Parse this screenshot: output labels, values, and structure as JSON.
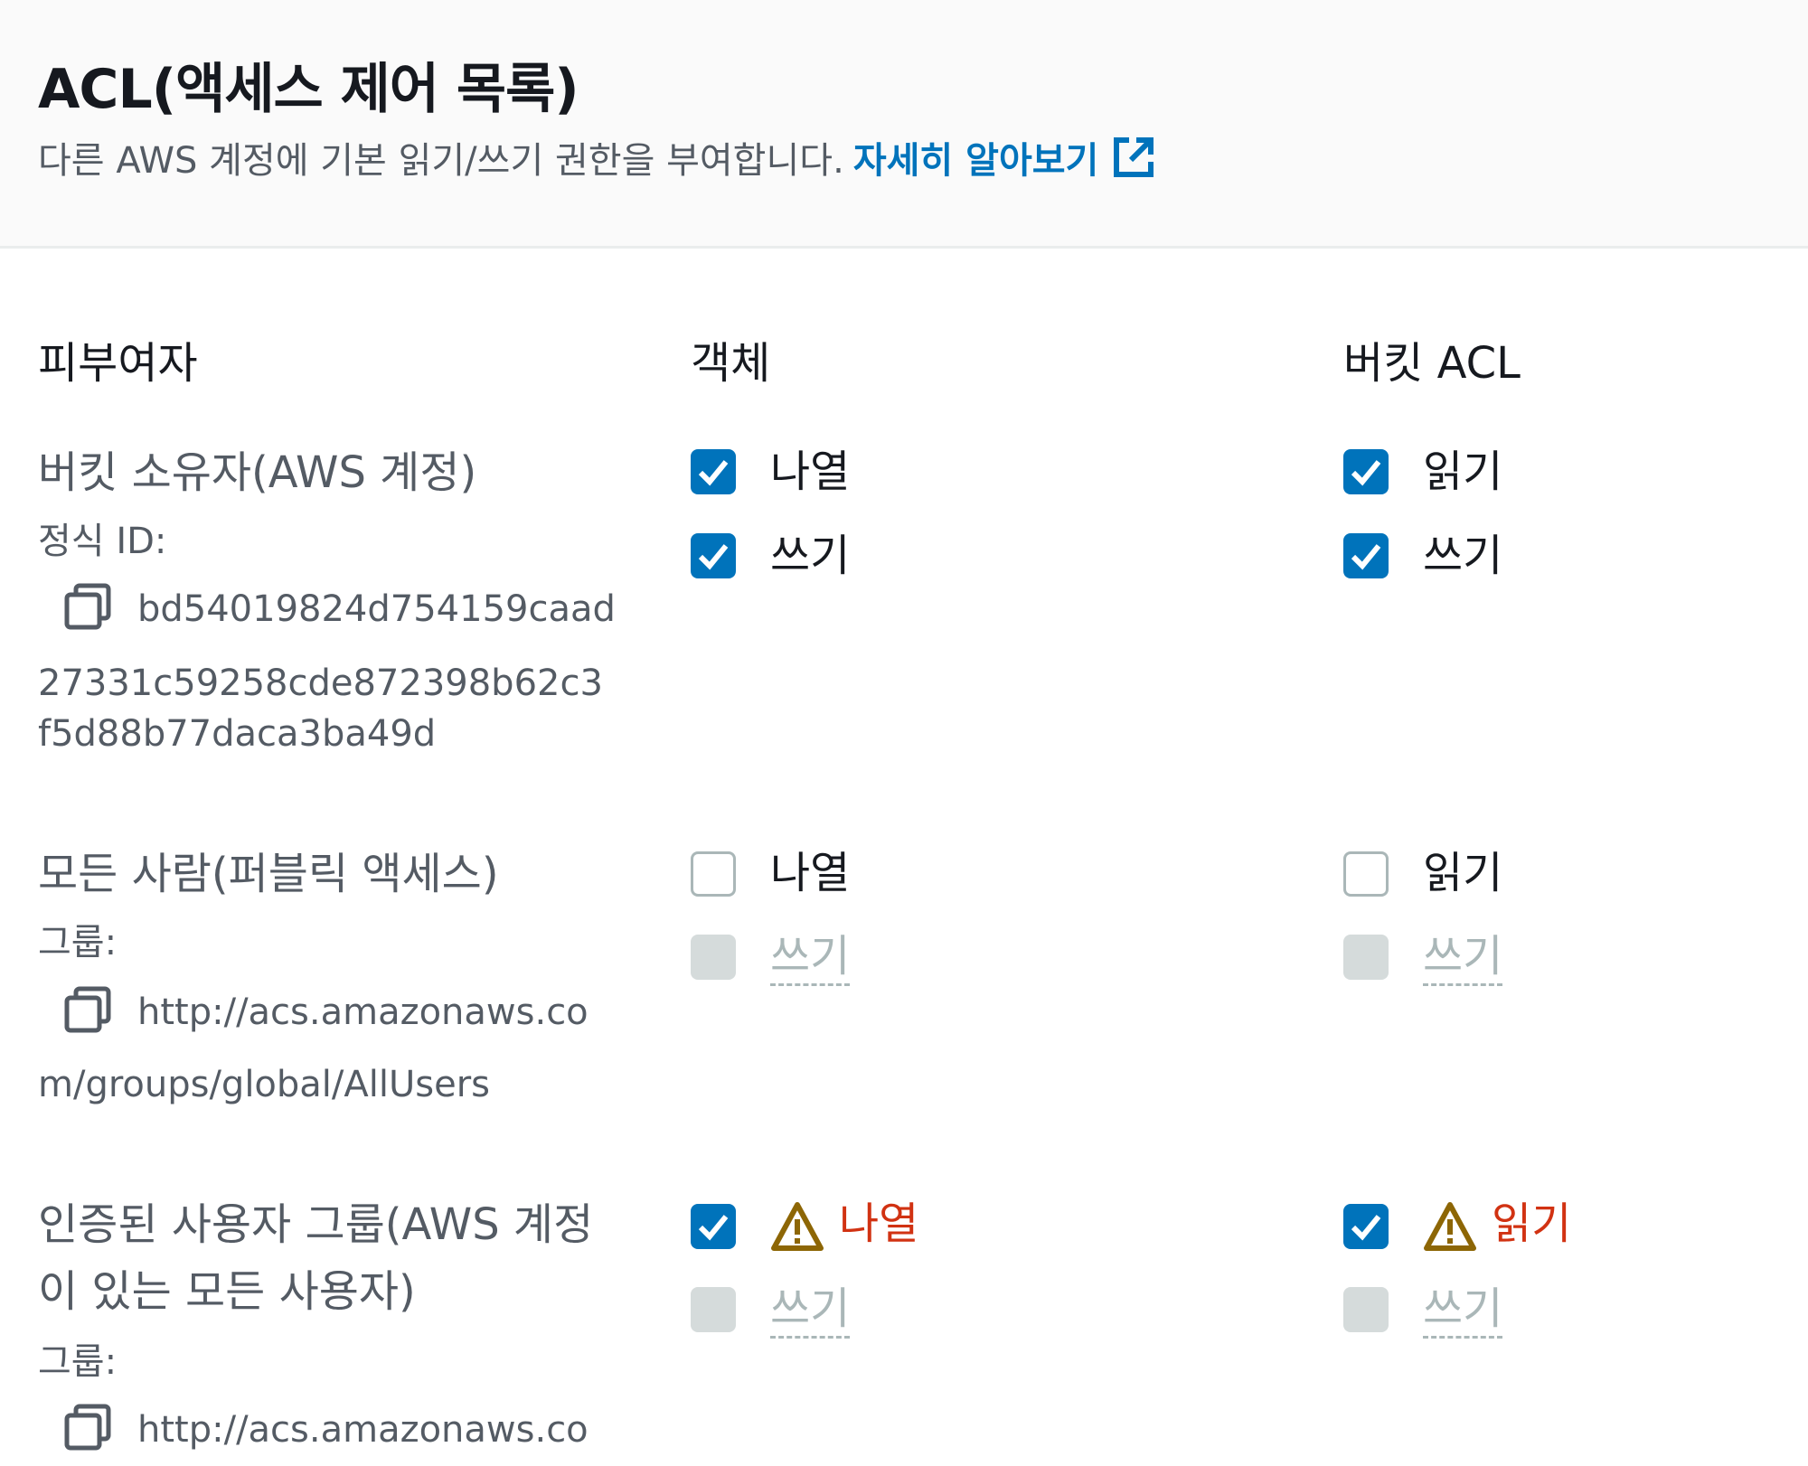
{
  "header": {
    "title": "ACL(액세스 제어 목록)",
    "description": "다른 AWS 계정에 기본 읽기/쓰기 권한을 부여합니다.",
    "learn_more": "자세히 알아보기"
  },
  "columns": {
    "grantee": "피부여자",
    "objects": "객체",
    "bucket_acl": "버킷 ACL"
  },
  "grantees": [
    {
      "name": "버킷 소유자(AWS 계정)",
      "id_label": "정식 ID:",
      "id_lines": [
        "bd54019824d754159caad",
        "27331c59258cde872398b62c3",
        "f5d88b77daca3ba49d"
      ],
      "objects": {
        "list_label": "나열",
        "list_checked": true,
        "write_label": "쓰기",
        "write_checked": true
      },
      "bucket": {
        "read_label": "읽기",
        "read_checked": true,
        "write_label": "쓰기",
        "write_checked": true
      }
    },
    {
      "name": "모든 사람(퍼블릭 액세스)",
      "id_label": "그룹:",
      "id_lines": [
        "http://acs.amazonaws.co",
        "m/groups/global/AllUsers"
      ],
      "objects": {
        "list_label": "나열",
        "list_checked": false,
        "write_label": "쓰기",
        "write_disabled": true
      },
      "bucket": {
        "read_label": "읽기",
        "read_checked": false,
        "write_label": "쓰기",
        "write_disabled": true
      }
    },
    {
      "name_line1": "인증된 사용자 그룹(AWS 계정",
      "name_line2": "이 있는 모든 사용자)",
      "id_label": "그룹:",
      "id_lines": [
        "http://acs.amazonaws.co"
      ],
      "objects": {
        "list_label": "나열",
        "list_checked": true,
        "list_warning": true,
        "write_label": "쓰기",
        "write_disabled": true
      },
      "bucket": {
        "read_label": "읽기",
        "read_checked": true,
        "read_warning": true,
        "write_label": "쓰기",
        "write_disabled": true
      }
    }
  ],
  "icons": {
    "external_link": "external-link-icon",
    "copy": "copy-icon",
    "warning": "warning-icon",
    "check": "check-icon"
  },
  "colors": {
    "link": "#0073bb",
    "checkbox_checked": "#0073bb",
    "warning_text": "#d13212",
    "warning_icon": "#8d6605",
    "disabled": "#d5dbdb"
  }
}
